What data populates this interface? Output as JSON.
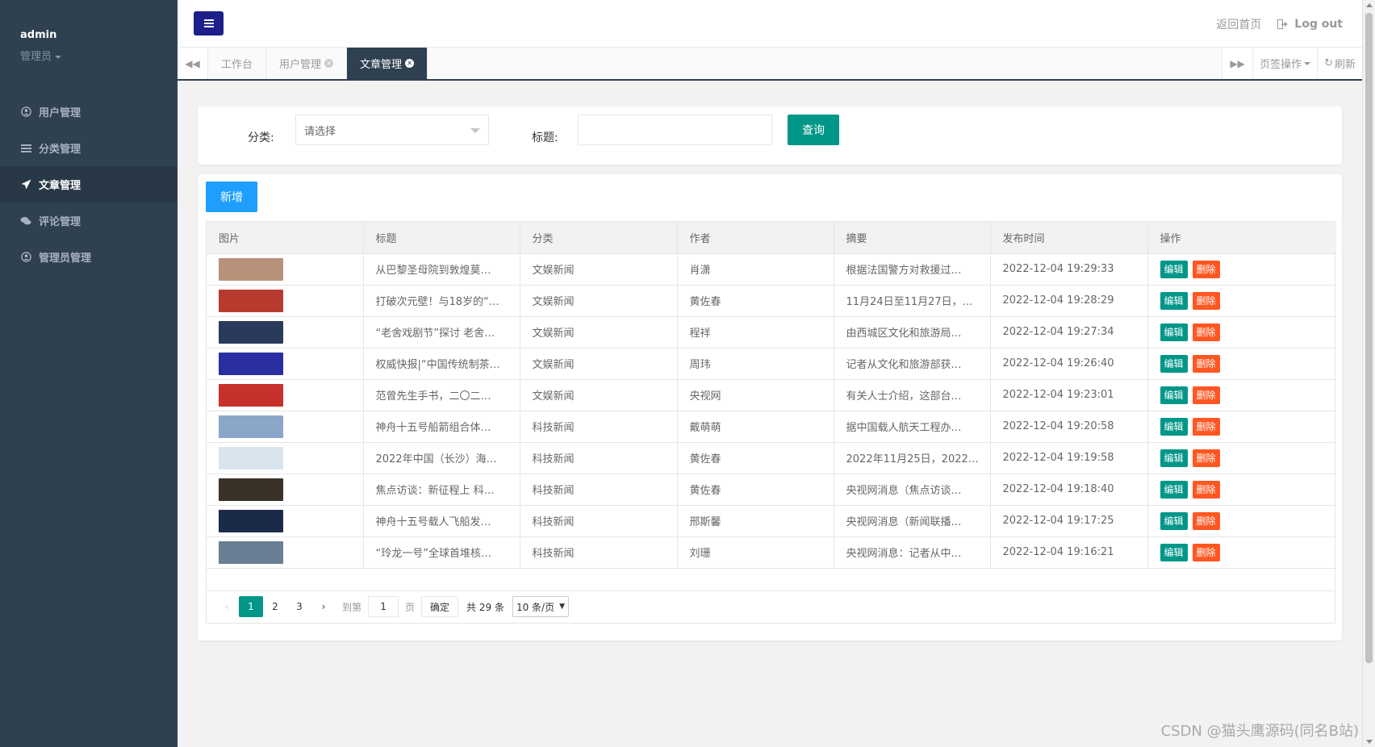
{
  "sidebar": {
    "username": "admin",
    "role": "管理员",
    "items": [
      {
        "label": "用户管理",
        "icon": "user-circle-icon",
        "active": false
      },
      {
        "label": "分类管理",
        "icon": "list-icon",
        "active": false
      },
      {
        "label": "文章管理",
        "icon": "paper-plane-icon",
        "active": true
      },
      {
        "label": "评论管理",
        "icon": "comments-icon",
        "active": false
      },
      {
        "label": "管理员管理",
        "icon": "user-admin-icon",
        "active": false
      }
    ]
  },
  "header": {
    "home_link": "返回首页",
    "logout": "Log out"
  },
  "tabs": {
    "items": [
      {
        "label": "工作台",
        "closable": false,
        "active": false
      },
      {
        "label": "用户管理",
        "closable": true,
        "active": false
      },
      {
        "label": "文章管理",
        "closable": true,
        "active": true
      }
    ],
    "tab_ops": "页签操作",
    "refresh": "刷新"
  },
  "search": {
    "category_label": "分类:",
    "category_placeholder": "请选择",
    "title_label": "标题:",
    "title_value": "",
    "query_button": "查询"
  },
  "toolbar": {
    "add_button": "新增"
  },
  "table": {
    "columns": [
      "图片",
      "标题",
      "分类",
      "作者",
      "摘要",
      "发布时间",
      "操作"
    ],
    "edit_label": "编辑",
    "delete_label": "删除",
    "rows": [
      {
        "title": "从巴黎圣母院到敦煌莫…",
        "category": "文娱新闻",
        "author": "肖潇",
        "summary": "根据法国警方对救援过…",
        "time": "2022-12-04 19:29:33",
        "thumb_color": "#b8917a"
      },
      {
        "title": "打破次元壁！与18岁的“…",
        "category": "文娱新闻",
        "author": "黄佐春",
        "summary": "11月24日至11月27日，…",
        "time": "2022-12-04 19:28:29",
        "thumb_color": "#b83a2e"
      },
      {
        "title": "“老舍戏剧节”探讨 老舍…",
        "category": "文娱新闻",
        "author": "程祥",
        "summary": "由西城区文化和旅游局…",
        "time": "2022-12-04 19:27:34",
        "thumb_color": "#2a3a5a"
      },
      {
        "title": "权威快报|“中国传统制茶…",
        "category": "文娱新闻",
        "author": "周玮",
        "summary": "记者从文化和旅游部获…",
        "time": "2022-12-04 19:26:40",
        "thumb_color": "#2a2ea0"
      },
      {
        "title": "范曾先生手书，二〇二…",
        "category": "文娱新闻",
        "author": "央视网",
        "summary": "有关人士介绍，这部台…",
        "time": "2022-12-04 19:23:01",
        "thumb_color": "#c6312b"
      },
      {
        "title": "神舟十五号船箭组合体…",
        "category": "科技新闻",
        "author": "戴萌萌",
        "summary": "据中国载人航天工程办…",
        "time": "2022-12-04 19:20:58",
        "thumb_color": "#8ba6c8"
      },
      {
        "title": "2022年中国（长沙）海…",
        "category": "科技新闻",
        "author": "黄佐春",
        "summary": "2022年11月25日，2022…",
        "time": "2022-12-04 19:19:58",
        "thumb_color": "#d8e4ee"
      },
      {
        "title": "焦点访谈：新征程上 科…",
        "category": "科技新闻",
        "author": "黄佐春",
        "summary": "央视网消息（焦点访谈…",
        "time": "2022-12-04 19:18:40",
        "thumb_color": "#3a3128"
      },
      {
        "title": "神舟十五号载人飞船发…",
        "category": "科技新闻",
        "author": "邢斯馨",
        "summary": "央视网消息（新闻联播…",
        "time": "2022-12-04 19:17:25",
        "thumb_color": "#1c2a4a"
      },
      {
        "title": "“玲龙一号”全球首堆核…",
        "category": "科技新闻",
        "author": "刘珊",
        "summary": "央视网消息：记者从中…",
        "time": "2022-12-04 19:16:21",
        "thumb_color": "#6a7f94"
      }
    ]
  },
  "pagination": {
    "pages": [
      "1",
      "2",
      "3"
    ],
    "current": "1",
    "goto_label": "到第",
    "goto_value": "1",
    "page_unit": "页",
    "confirm": "确定",
    "total": "共 29 条",
    "per_page": "10 条/页"
  },
  "watermark": "CSDN @猫头鹰源码(同名B站)"
}
